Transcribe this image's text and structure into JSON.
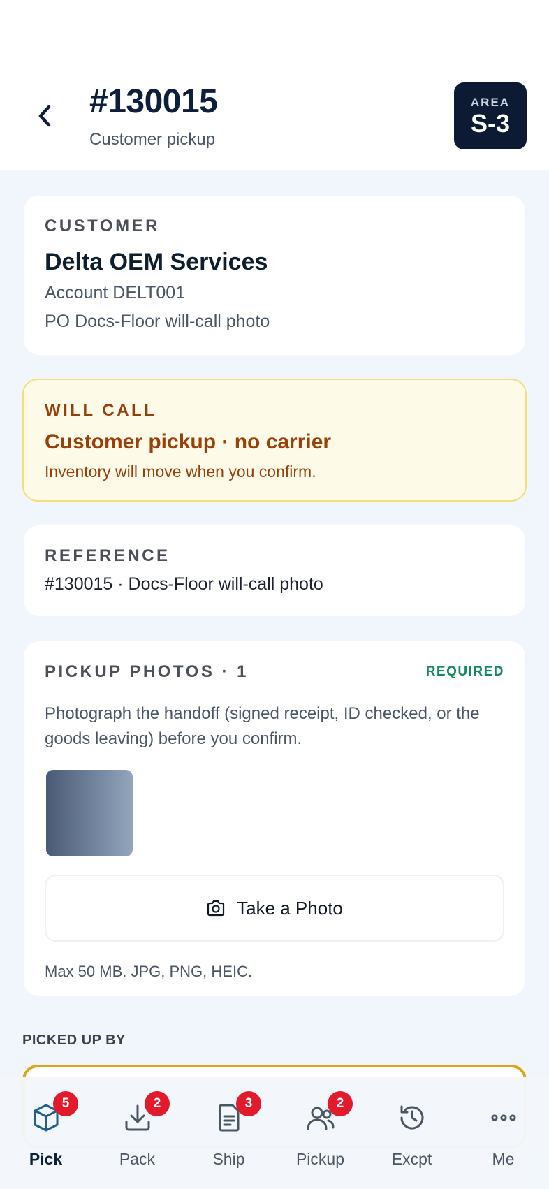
{
  "header": {
    "order_id": "#130015",
    "subtitle": "Customer pickup",
    "area_label": "AREA",
    "area_value": "S-3"
  },
  "customer": {
    "eyebrow": "CUSTOMER",
    "name": "Delta OEM Services",
    "account": "Account DELT001",
    "po": "PO Docs-Floor will-call photo"
  },
  "will_call": {
    "eyebrow": "WILL CALL",
    "title": "Customer pickup · no carrier",
    "note": "Inventory will move when you confirm."
  },
  "reference": {
    "eyebrow": "REFERENCE",
    "value": "#130015 · Docs-Floor will-call photo"
  },
  "photos": {
    "eyebrow": "PICKUP PHOTOS · 1",
    "required": "REQUIRED",
    "description": "Photograph the handoff (signed receipt, ID checked, or the goods leaving) before you confirm.",
    "take_photo_label": "Take a Photo",
    "hint": "Max 50 MB. JPG, PNG, HEIC."
  },
  "picked_up_by": {
    "label": "PICKED UP BY",
    "value": ""
  },
  "tabs": [
    {
      "label": "Pick",
      "badge": "5",
      "icon": "box-icon",
      "active": true
    },
    {
      "label": "Pack",
      "badge": "2",
      "icon": "download-icon",
      "active": false
    },
    {
      "label": "Ship",
      "badge": "3",
      "icon": "document-icon",
      "active": false
    },
    {
      "label": "Pickup",
      "badge": "2",
      "icon": "users-icon",
      "active": false
    },
    {
      "label": "Excpt",
      "badge": "",
      "icon": "history-icon",
      "active": false
    },
    {
      "label": "Me",
      "badge": "",
      "icon": "more-icon",
      "active": false
    }
  ],
  "colors": {
    "brand_dark": "#0c1a33",
    "warning_bg": "#fefae8",
    "warning_text": "#983f0a",
    "required_green": "#138a5b",
    "badge_red": "#e21a2c",
    "field_focus": "#e2a21b"
  }
}
